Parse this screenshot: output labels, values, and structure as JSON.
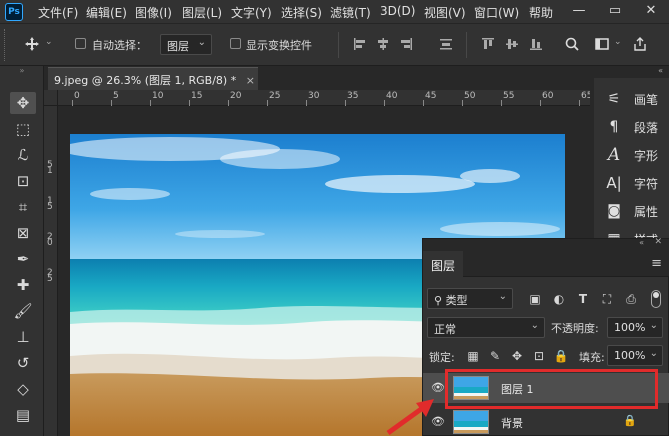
{
  "app": {
    "logo_text": "Ps",
    "menu": [
      "文件(F)",
      "编辑(E)",
      "图像(I)",
      "图层(L)",
      "文字(Y)",
      "选择(S)",
      "滤镜(T)",
      "3D(D)",
      "视图(V)",
      "窗口(W)",
      "帮助"
    ]
  },
  "options_bar": {
    "auto_select_label": "自动选择：",
    "auto_select_value": "图层",
    "show_transform_label": "显示变换控件"
  },
  "document": {
    "tab_title": "9.jpeg @ 26.3% (图层 1, RGB/8) *",
    "close_symbol": "×",
    "ruler_top": [
      "0",
      "5",
      "10",
      "15",
      "20",
      "25",
      "30",
      "35",
      "40",
      "45",
      "50",
      "55",
      "60",
      "65"
    ],
    "ruler_left": [
      "5",
      "1",
      "1",
      "5",
      "2",
      "0",
      "2",
      "5"
    ]
  },
  "right_panel": {
    "items": [
      {
        "icon": "brush-settings-icon",
        "label": "画笔"
      },
      {
        "icon": "paragraph-icon",
        "label": "段落"
      },
      {
        "icon": "character-style-icon",
        "label": "字形"
      },
      {
        "icon": "character-icon",
        "label": "字符"
      },
      {
        "icon": "properties-icon",
        "label": "属性"
      }
    ],
    "partial_label": "样式"
  },
  "layers_panel": {
    "title": "图层",
    "filter_kind": "类型",
    "blend_mode": "正常",
    "opacity_label": "不透明度:",
    "opacity_value": "100%",
    "lock_label": "锁定:",
    "fill_label": "填充:",
    "fill_value": "100%",
    "layers": [
      {
        "name": "图层 1",
        "selected": true
      },
      {
        "name": "背景",
        "locked": true
      }
    ]
  },
  "colors": {
    "accent_highlight": "#e12b2b",
    "panel_bg": "#323232",
    "app_bg": "#282828"
  }
}
